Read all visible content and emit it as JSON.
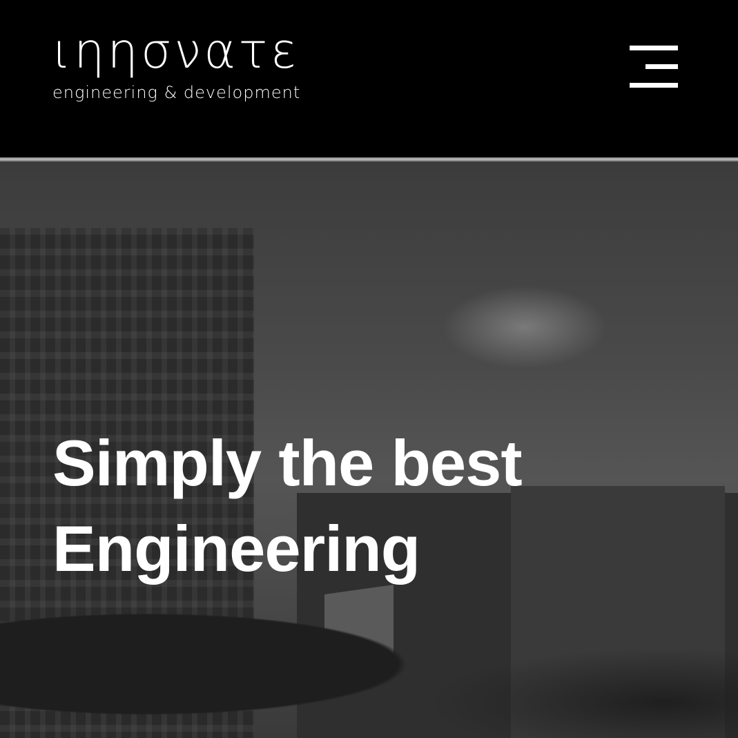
{
  "header": {
    "logo_main": "ιηησνατε",
    "logo_sub": "engineering & development",
    "menu_icon": "hamburger-menu-icon"
  },
  "hero": {
    "headline_line1": "Simply the best",
    "headline_line2": "Engineering"
  }
}
